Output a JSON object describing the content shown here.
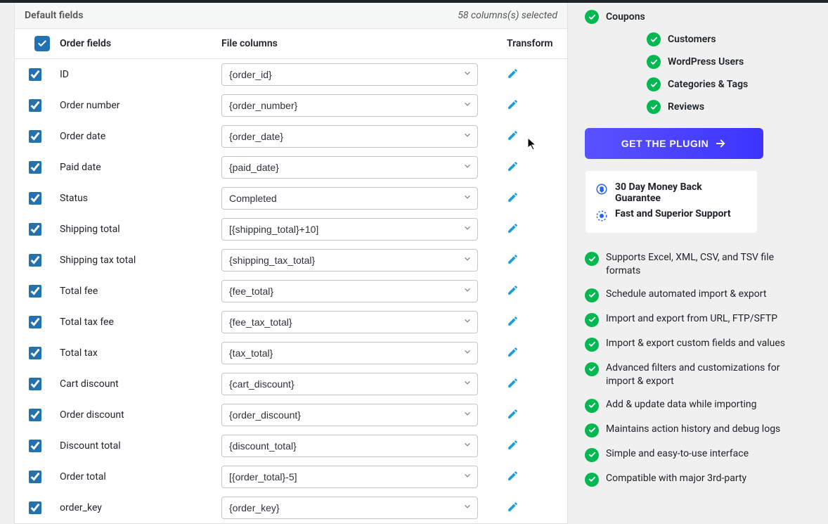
{
  "panel": {
    "title": "Default fields",
    "selected_text": "58 columns(s) selected",
    "columns": {
      "order": "Order fields",
      "file": "File columns",
      "transform": "Transform"
    }
  },
  "rows": [
    {
      "label": "ID",
      "value": "{order_id}"
    },
    {
      "label": "Order number",
      "value": "{order_number}"
    },
    {
      "label": "Order date",
      "value": "{order_date}"
    },
    {
      "label": "Paid date",
      "value": "{paid_date}"
    },
    {
      "label": "Status",
      "value": "Completed"
    },
    {
      "label": "Shipping total",
      "value": "[{shipping_total}+10]"
    },
    {
      "label": "Shipping tax total",
      "value": "{shipping_tax_total}"
    },
    {
      "label": "Total fee",
      "value": "{fee_total}"
    },
    {
      "label": "Total tax fee",
      "value": "{fee_tax_total}"
    },
    {
      "label": "Total tax",
      "value": "{tax_total}"
    },
    {
      "label": "Cart discount",
      "value": "{cart_discount}"
    },
    {
      "label": "Order discount",
      "value": "{order_discount}"
    },
    {
      "label": "Discount total",
      "value": "{discount_total}"
    },
    {
      "label": "Order total",
      "value": "[{order_total}-5]"
    },
    {
      "label": "order_key",
      "value": "{order_key}"
    }
  ],
  "sidebar": {
    "top_items": [
      {
        "label": "Coupons",
        "indent": false
      },
      {
        "label": "Customers",
        "indent": true
      },
      {
        "label": "WordPress Users",
        "indent": true
      },
      {
        "label": "Categories & Tags",
        "indent": true
      },
      {
        "label": "Reviews",
        "indent": true
      }
    ],
    "cta": "GET THE PLUGIN",
    "guarantee": {
      "line1": "30 Day Money Back Guarantee",
      "line2": "Fast and Superior Support"
    },
    "features": [
      "Supports Excel, XML, CSV, and TSV file formats",
      "Schedule automated import & export",
      "Import and export from URL, FTP/SFTP",
      "Import & export custom fields and values",
      "Advanced filters and customizations for import & export",
      "Add & update data while importing",
      "Maintains action history and debug logs",
      "Simple and easy-to-use interface",
      "Compatible with major 3rd-party"
    ]
  }
}
